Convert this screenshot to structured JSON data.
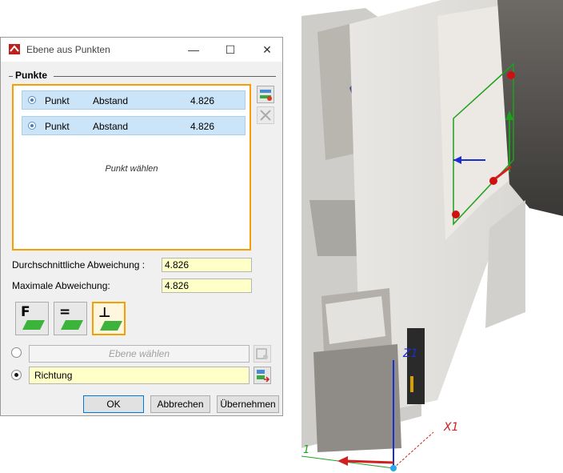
{
  "window": {
    "title": "Ebene aus Punkten",
    "minimize_glyph": "—",
    "maximize_glyph": "☐",
    "close_glyph": "✕"
  },
  "points_group": {
    "label": "Punkte",
    "rows": [
      {
        "name": "Punkt",
        "distance_label": "Abstand",
        "value": "4.826"
      },
      {
        "name": "Punkt",
        "distance_label": "Abstand",
        "value": "4.826"
      }
    ],
    "placeholder": "Punkt wählen"
  },
  "stats": {
    "avg_label": "Durchschnittliche Abweichung :",
    "avg_value": "4.826",
    "max_label": "Maximale Abweichung:",
    "max_value": "4.826"
  },
  "mode_buttons": [
    {
      "label": "F",
      "icon": "plane-face-icon",
      "selected": false
    },
    {
      "label": "=",
      "icon": "plane-parallel-icon",
      "selected": false
    },
    {
      "label": "⊥",
      "icon": "plane-perpendicular-icon",
      "selected": true
    }
  ],
  "options": {
    "plane_placeholder": "Ebene wählen",
    "direction_value": "Richtung",
    "selected": "direction"
  },
  "buttons": {
    "ok": "OK",
    "cancel": "Abbrechen",
    "apply": "Übernehmen"
  },
  "viewport": {
    "axis_z": "Z1",
    "axis_x": "X1",
    "axis_y": "1"
  },
  "colors": {
    "accent": "#f5a000",
    "selection": "#cce4f7",
    "field_yellow": "#ffffc8",
    "plane_green": "#1ea01e"
  }
}
